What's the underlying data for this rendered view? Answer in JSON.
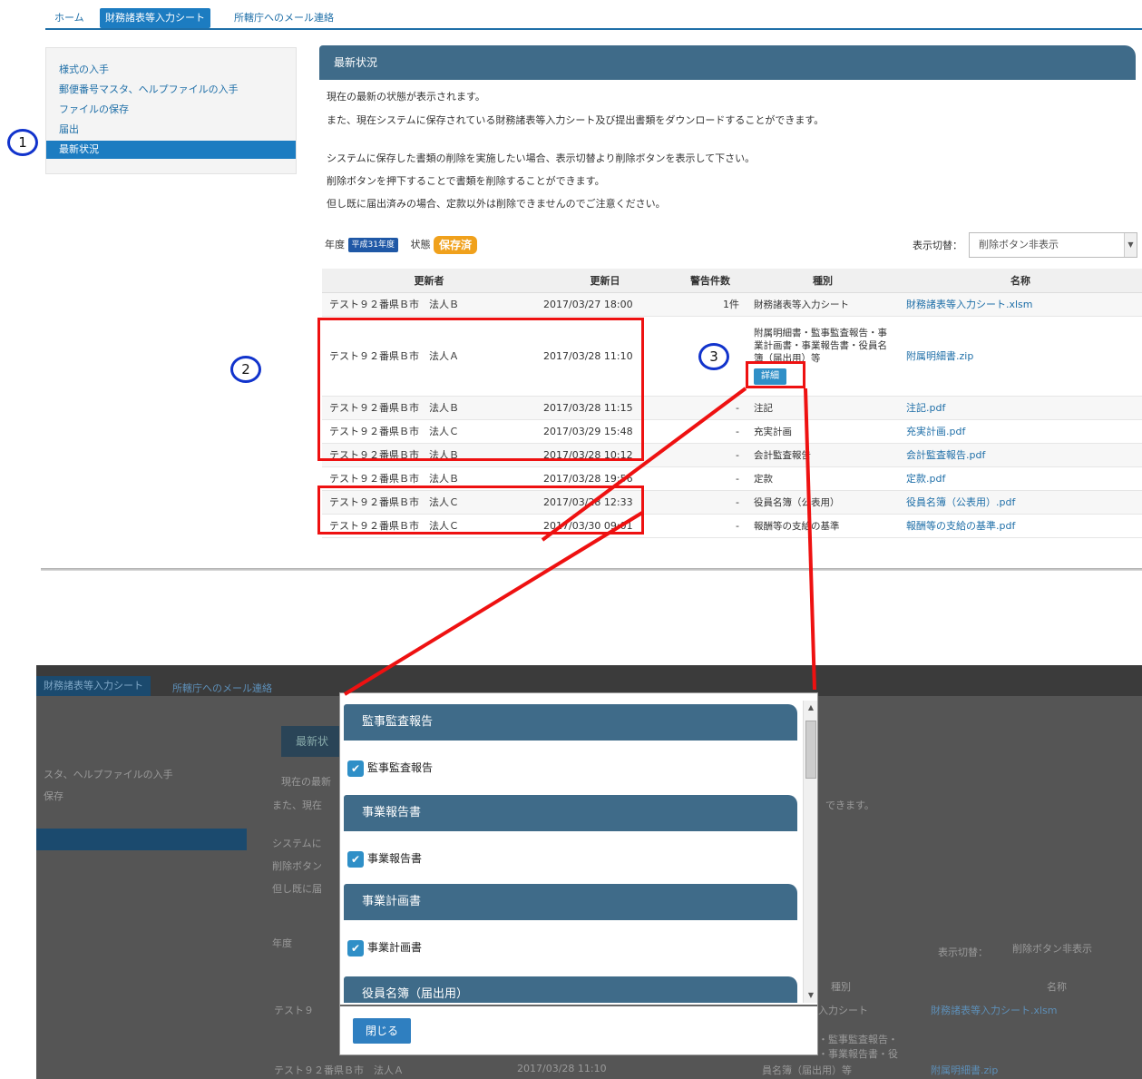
{
  "top": {
    "nav": {
      "home": "ホーム",
      "financial_sheet": "財務諸表等入力シート",
      "mail": "所轄庁へのメール連絡"
    },
    "sidebar": {
      "items": [
        "様式の入手",
        "郵便番号マスタ、ヘルプファイルの入手",
        "ファイルの保存",
        "届出",
        "最新状況"
      ]
    },
    "panel_title": "最新状況",
    "description": [
      "現在の最新の状態が表示されます。",
      "また、現在システムに保存されている財務諸表等入力シート及び提出書類をダウンロードすることができます。",
      "システムに保存した書類の削除を実施したい場合、表示切替より削除ボタンを表示して下さい。",
      "削除ボタンを押下することで書類を削除することができます。",
      "但し既に届出済みの場合、定款以外は削除できませんのでご注意ください。"
    ],
    "year_label": "年度",
    "year_badge": "平成31年度",
    "status_label": "状態",
    "status_badge": "保存済",
    "display_toggle_label": "表示切替：",
    "display_toggle_value": "削除ボタン非表示",
    "table": {
      "headers": [
        "更新者",
        "更新日",
        "警告件数",
        "種別",
        "名称"
      ],
      "rows": [
        {
          "updater": "テスト９２番県Ｂ市　法人Ｂ",
          "date": "2017/03/27 18:00",
          "warnings": "1件",
          "type": "財務諸表等入力シート",
          "name": "財務諸表等入力シート.xlsm"
        },
        {
          "updater": "テスト９２番県Ｂ市　法人Ａ",
          "date": "2017/03/28 11:10",
          "warnings": "",
          "type": "附属明細書・監事監査報告・事業計画書・事業報告書・役員名簿（届出用）等",
          "name": "附属明細書.zip",
          "detail_button": "詳細"
        },
        {
          "updater": "テスト９２番県Ｂ市　法人Ｂ",
          "date": "2017/03/28 11:15",
          "warnings": "-",
          "type": "注記",
          "name": "注記.pdf"
        },
        {
          "updater": "テスト９２番県Ｂ市　法人Ｃ",
          "date": "2017/03/29 15:48",
          "warnings": "-",
          "type": "充実計画",
          "name": "充実計画.pdf"
        },
        {
          "updater": "テスト９２番県Ｂ市　法人Ｂ",
          "date": "2017/03/28 10:12",
          "warnings": "-",
          "type": "会計監査報告",
          "name": "会計監査報告.pdf"
        },
        {
          "updater": "テスト９２番県Ｂ市　法人Ｂ",
          "date": "2017/03/28 19:56",
          "warnings": "-",
          "type": "定款",
          "name": "定款.pdf"
        },
        {
          "updater": "テスト９２番県Ｂ市　法人Ｃ",
          "date": "2017/03/28 12:33",
          "warnings": "-",
          "type": "役員名簿（公表用）",
          "name": "役員名簿（公表用）.pdf"
        },
        {
          "updater": "テスト９２番県Ｂ市　法人Ｃ",
          "date": "2017/03/30 09:01",
          "warnings": "-",
          "type": "報酬等の支給の基準",
          "name": "報酬等の支給の基準.pdf"
        }
      ]
    },
    "markers": [
      "1",
      "2",
      "3"
    ]
  },
  "bottom": {
    "background": {
      "tab_active": "財務諸表等入力シート",
      "tab_mail": "所轄庁へのメール連絡",
      "side1": "スタ、ヘルプファイルの入手",
      "side2": "保存",
      "panel": "最新状",
      "desc1": "現在の最新",
      "desc2": "また、現在",
      "desc3": "システムに",
      "desc4": "削除ボタン",
      "desc5": "但し既に届",
      "desc_tail": "できます。",
      "year": "年度",
      "display_toggle": "表示切替：",
      "display_value": "削除ボタン非表示",
      "col_type": "種別",
      "col_name": "名称",
      "row1_updater": "テスト９",
      "row1_type": "入力シート",
      "row1_name": "財務諸表等入力シート.xlsm",
      "row2_updater": "テスト９２番県Ｂ市　法人Ａ",
      "row2_date": "2017/03/28 11:10",
      "row2_type1": "・監事監査報告・",
      "row2_type2": "・事業報告書・役",
      "row2_type3": "員名簿（届出用）等",
      "row2_name": "附属明細書.zip"
    },
    "modal": {
      "sections": [
        {
          "title": "監事監査報告",
          "item": "監事監査報告"
        },
        {
          "title": "事業報告書",
          "item": "事業報告書"
        },
        {
          "title": "事業計画書",
          "item": "事業計画書"
        },
        {
          "title": "役員名簿（届出用）",
          "item": ""
        }
      ],
      "close_label": "閉じる"
    }
  },
  "colors": {
    "accent": "#1c7cc1",
    "header": "#3f6b89",
    "highlight": "#ee1111",
    "marker": "#1133cc",
    "status": "#f0a11c"
  }
}
